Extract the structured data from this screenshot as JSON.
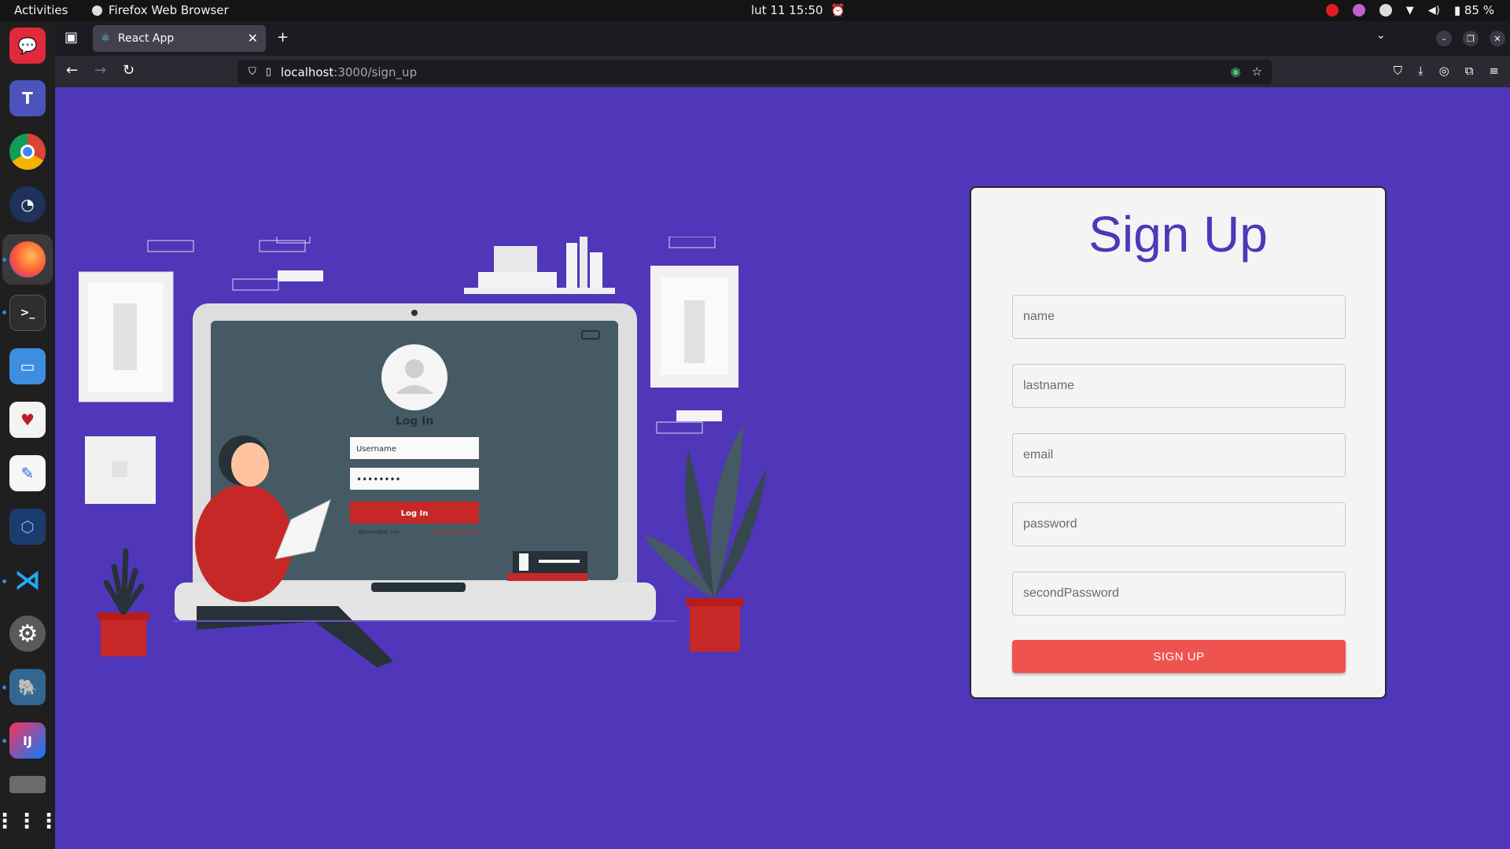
{
  "system_bar": {
    "activities": "Activities",
    "app_name": "Firefox Web Browser",
    "datetime": "lut 11  15:50",
    "battery": "85 %"
  },
  "browser": {
    "tab_title": "React App",
    "url_host": "localhost",
    "url_path": ":3000/sign_up"
  },
  "signup": {
    "title": "Sign Up",
    "fields": [
      {
        "placeholder": "name"
      },
      {
        "placeholder": "lastname"
      },
      {
        "placeholder": "email"
      },
      {
        "placeholder": "password"
      },
      {
        "placeholder": "secondPassword"
      }
    ],
    "submit_label": "SIGN UP"
  },
  "illustration": {
    "login_title": "Log In",
    "username_placeholder": "Username",
    "password_mask": "••••••••",
    "login_button": "Log In",
    "remember_me": "Remember me",
    "forgot_password": "Forgot Password?"
  },
  "colors": {
    "page_bg": "#5036b8",
    "accent_red": "#ef5350",
    "title_purple": "#5036b8"
  },
  "dock_icons": [
    "rocketchat-icon",
    "teams-icon",
    "chrome-icon",
    "mattermost-icon",
    "firefox-icon",
    "terminal-icon",
    "files-icon",
    "solitaire-icon",
    "text-editor-icon",
    "virtualbox-icon",
    "vscode-icon",
    "settings-icon",
    "postgres-icon",
    "intellij-icon",
    "disk-icon",
    "app-grid-icon"
  ]
}
